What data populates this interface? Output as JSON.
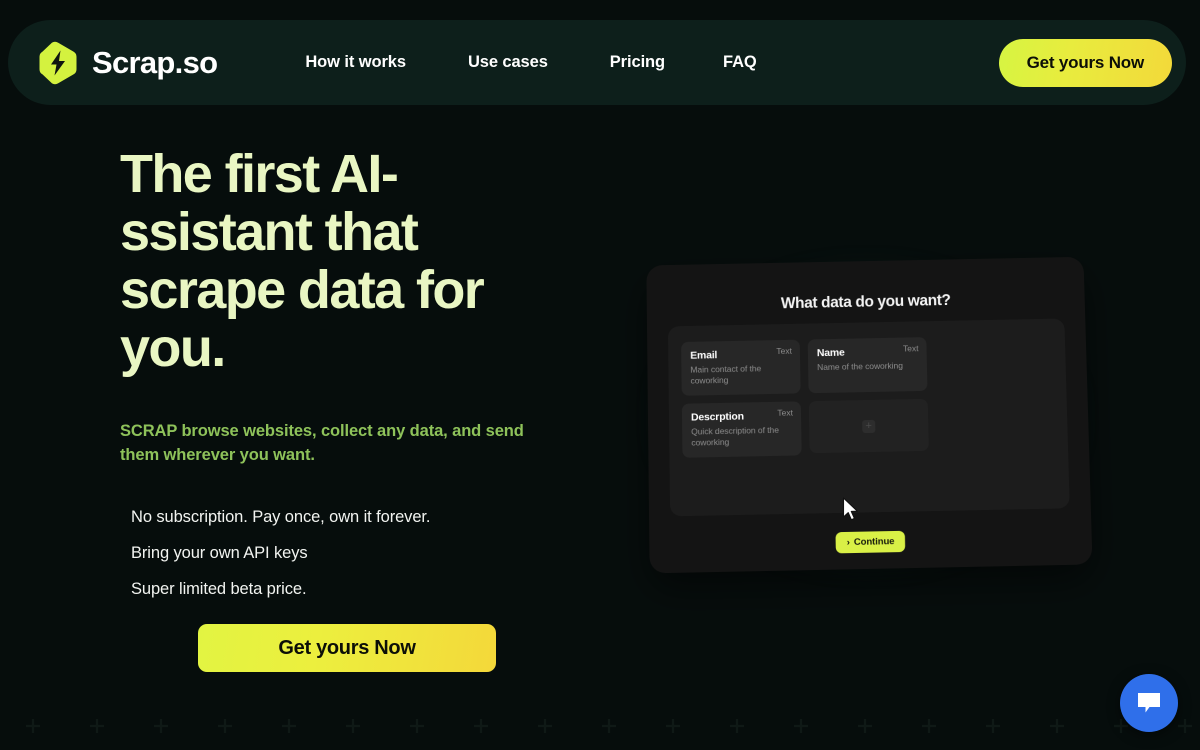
{
  "brand": {
    "name": "Scrap.so",
    "logo_icon": "lightning-bolt-hexagon-icon",
    "accent_lime": "#d6f542",
    "accent_gold": "#f3d93a",
    "page_background": "#060d0c",
    "navbar_background": "#0d1f1b"
  },
  "nav": {
    "links": [
      {
        "label": "How it works"
      },
      {
        "label": "Use cases"
      },
      {
        "label": "Pricing"
      },
      {
        "label": "FAQ"
      }
    ],
    "cta_label": "Get yours Now"
  },
  "hero": {
    "headline": "The first AI-ssistant that scrape data for you.",
    "subheadline": "SCRAP browse websites, collect any data, and send them wherever you want.",
    "headline_color": "#e9f6c3",
    "subheadline_color": "#8ec25a",
    "benefits": [
      {
        "label": "No subscription. Pay once, own it forever."
      },
      {
        "label": "Bring your own API keys"
      },
      {
        "label": "Super limited beta price."
      }
    ],
    "cta_label": "Get yours Now"
  },
  "mockup": {
    "title": "What data do you want?",
    "fields": [
      {
        "label": "Email",
        "description": "Main contact of the coworking",
        "type": "Text"
      },
      {
        "label": "Name",
        "description": "Name of the coworking",
        "type": "Text"
      },
      {
        "label": "Descrption",
        "description": "Quick description of the coworking",
        "type": "Text"
      }
    ],
    "add_field_icon": "plus-icon",
    "continue_label": "Continue",
    "continue_chevron": "›",
    "cursor_icon": "mouse-pointer-icon",
    "continue_color": "#d9f046"
  },
  "chat": {
    "icon": "chat-bubble-icon",
    "color": "#2f6fea"
  }
}
